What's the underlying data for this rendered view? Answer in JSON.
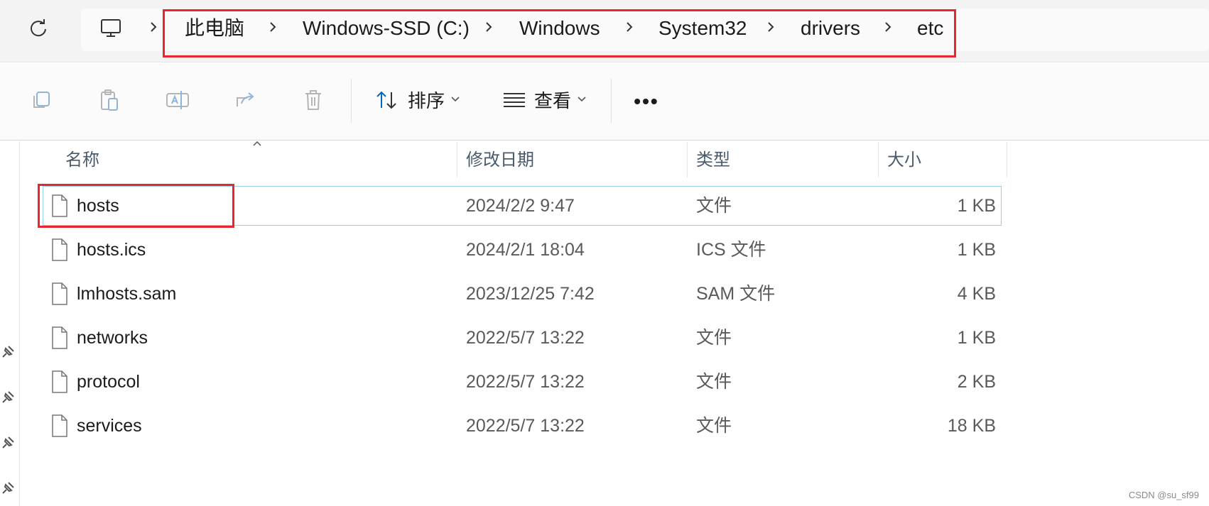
{
  "breadcrumb": {
    "items": [
      "此电脑",
      "Windows-SSD (C:)",
      "Windows",
      "System32",
      "drivers",
      "etc"
    ]
  },
  "toolbar": {
    "sort_label": "排序",
    "view_label": "查看",
    "more_label": "•••"
  },
  "columns": {
    "name": "名称",
    "date": "修改日期",
    "type": "类型",
    "size": "大小"
  },
  "files": [
    {
      "name": "hosts",
      "date": "2024/2/2 9:47",
      "type": "文件",
      "size": "1 KB",
      "selected": true
    },
    {
      "name": "hosts.ics",
      "date": "2024/2/1 18:04",
      "type": "ICS 文件",
      "size": "1 KB"
    },
    {
      "name": "lmhosts.sam",
      "date": "2023/12/25 7:42",
      "type": "SAM 文件",
      "size": "4 KB"
    },
    {
      "name": "networks",
      "date": "2022/5/7 13:22",
      "type": "文件",
      "size": "1 KB"
    },
    {
      "name": "protocol",
      "date": "2022/5/7 13:22",
      "type": "文件",
      "size": "2 KB"
    },
    {
      "name": "services",
      "date": "2022/5/7 13:22",
      "type": "文件",
      "size": "18 KB"
    }
  ],
  "watermark": "CSDN @su_sf99",
  "colors": {
    "annotation": "#e8262f",
    "selection_border": "#99d1ea",
    "accent": "#0067c0"
  },
  "icons": [
    "refresh-icon",
    "computer-icon",
    "chevron-right-icon",
    "copy-icon",
    "paste-icon",
    "rename-icon",
    "share-icon",
    "delete-icon",
    "sort-icon",
    "view-icon",
    "more-icon",
    "pin-icon",
    "file-icon"
  ]
}
